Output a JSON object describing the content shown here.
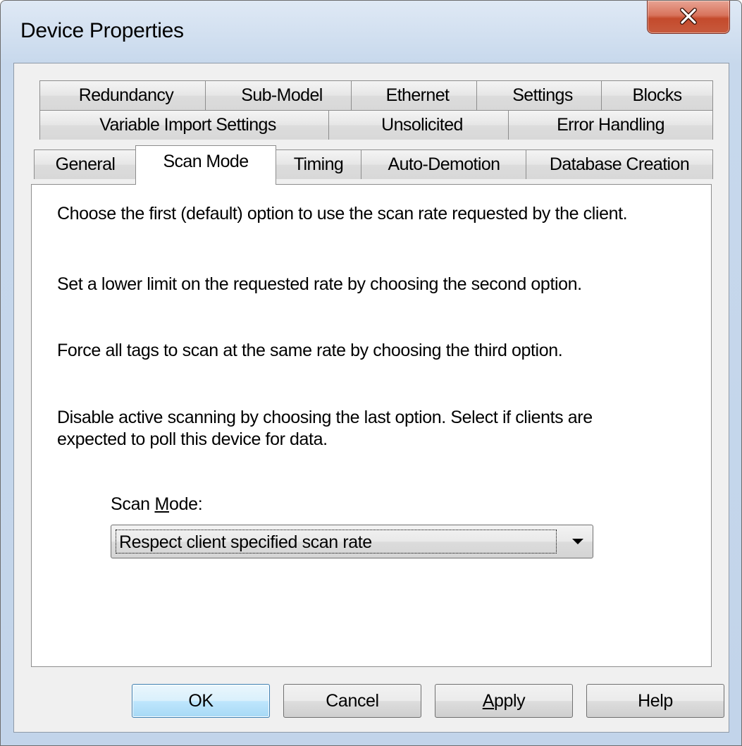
{
  "window": {
    "title": "Device Properties"
  },
  "tabs": {
    "row1": [
      "Redundancy",
      "Sub-Model",
      "Ethernet",
      "Settings",
      "Blocks"
    ],
    "row2": [
      "Variable Import Settings",
      "Unsolicited",
      "Error Handling"
    ],
    "row3": [
      "General",
      "Scan Mode",
      "Timing",
      "Auto-Demotion",
      "Database Creation"
    ],
    "selected": "Scan Mode"
  },
  "panel": {
    "paragraphs": [
      "Choose the first (default) option to use the scan rate requested by the client.",
      "Set a lower limit on the requested rate by choosing the second option.",
      "Force all tags to scan at the same rate by choosing the third option.",
      "Disable active scanning by choosing the last option. Select if clients are expected to poll this device for data."
    ],
    "scan_mode_label_prefix": "Scan ",
    "scan_mode_label_mnemonic": "M",
    "scan_mode_label_suffix": "ode:",
    "scan_mode_value": "Respect client specified scan rate"
  },
  "buttons": {
    "ok": "OK",
    "cancel": "Cancel",
    "apply_mnemonic": "A",
    "apply_rest": "pply",
    "help": "Help"
  },
  "icons": {
    "close": "close-icon",
    "dropdown": "chevron-down-icon"
  },
  "colors": {
    "close_button": "#c44a2c",
    "default_button_border": "#3c7fb1",
    "panel_background": "#ffffff",
    "dialog_background": "#f0f0f0"
  }
}
